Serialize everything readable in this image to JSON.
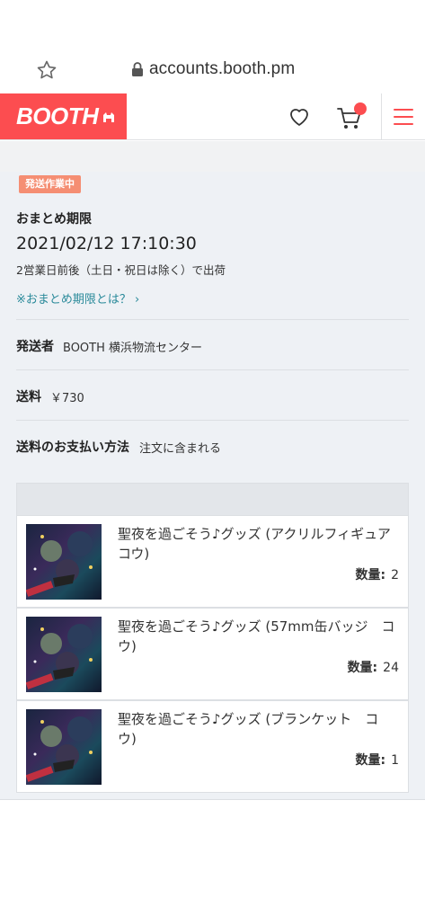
{
  "browser": {
    "url": "accounts.booth.pm"
  },
  "header": {
    "logo_text": "BOOTH",
    "brand_color": "#fc4d50",
    "icons": [
      "heart-icon",
      "cart-icon",
      "hamburger-menu-icon"
    ]
  },
  "order": {
    "status_badge": "発送作業中",
    "deadline_label": "おまとめ期限",
    "deadline_value": "2021/02/12 17:10:30",
    "shipping_note": "2営業日前後（土日・祝日は除く）で出荷",
    "help_link": "※おまとめ期限とは？ ›",
    "sender_label": "発送者",
    "sender_value": "BOOTH 横浜物流センター",
    "fee_label": "送料",
    "fee_value": "￥730",
    "payment_label": "送料のお支払い方法",
    "payment_value": "注文に含まれる"
  },
  "items": [
    {
      "title": "聖夜を過ごそう♪グッズ (アクリルフィギュア　コウ)",
      "qty_label": "数量:",
      "qty": "2"
    },
    {
      "title": "聖夜を過ごそう♪グッズ (57mm缶バッジ　コウ)",
      "qty_label": "数量:",
      "qty": "24"
    },
    {
      "title": "聖夜を過ごそう♪グッズ (ブランケット　コウ)",
      "qty_label": "数量:",
      "qty": "1"
    }
  ]
}
